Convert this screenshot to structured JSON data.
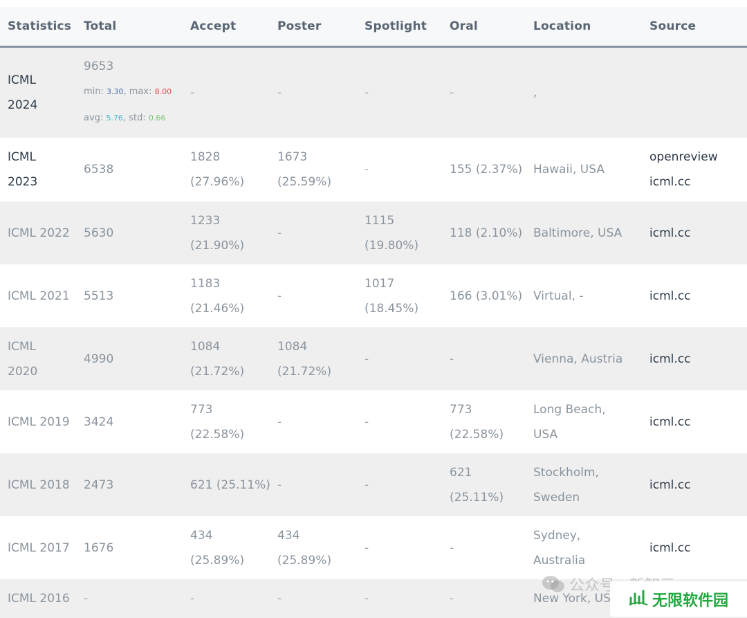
{
  "headers": [
    "Statistics",
    "Total",
    "Accept",
    "Poster",
    "Spotlight",
    "Oral",
    "Location",
    "Source"
  ],
  "rows": [
    {
      "stat_line1": "ICML",
      "stat_line2": "2024",
      "total": "9653",
      "total_min_label": "min: ",
      "total_min": "3.30",
      "total_max_label": ", max: ",
      "total_max": "8.00",
      "total_avg_label": "avg: ",
      "total_avg": "5.76",
      "total_std_label": ", std: ",
      "total_std": "0.66",
      "accept": "-",
      "poster": "-",
      "spotlight": "-",
      "oral": "-",
      "location": ",",
      "source": ""
    },
    {
      "stat_line1": "ICML",
      "stat_line2": "2023",
      "total": "6538",
      "accept_line1": "1828",
      "accept_line2": "(27.96%)",
      "poster_line1": "1673",
      "poster_line2": "(25.59%)",
      "spotlight": "-",
      "oral": "155 (2.37%)",
      "location": "Hawaii, USA",
      "source_line1": "openreview",
      "source_line2": "icml.cc"
    },
    {
      "stat": "ICML 2022",
      "total": "5630",
      "accept_line1": "1233",
      "accept_line2": "(21.90%)",
      "poster": "-",
      "spotlight_line1": "1115",
      "spotlight_line2": "(19.80%)",
      "oral": "118 (2.10%)",
      "location": "Baltimore, USA",
      "source": "icml.cc"
    },
    {
      "stat": "ICML 2021",
      "total": "5513",
      "accept_line1": "1183",
      "accept_line2": "(21.46%)",
      "poster": "-",
      "spotlight_line1": "1017",
      "spotlight_line2": "(18.45%)",
      "oral": "166 (3.01%)",
      "location": "Virtual, -",
      "source": "icml.cc"
    },
    {
      "stat_line1": "ICML",
      "stat_line2": "2020",
      "total": "4990",
      "accept_line1": "1084",
      "accept_line2": "(21.72%)",
      "poster_line1": "1084",
      "poster_line2": "(21.72%)",
      "spotlight": "-",
      "oral": "-",
      "location": "Vienna, Austria",
      "source": "icml.cc"
    },
    {
      "stat": "ICML 2019",
      "total": "3424",
      "accept_line1": "773",
      "accept_line2": "(22.58%)",
      "poster": "-",
      "spotlight": "-",
      "oral_line1": "773",
      "oral_line2": "(22.58%)",
      "location_line1": "Long Beach,",
      "location_line2": "USA",
      "source": "icml.cc"
    },
    {
      "stat": "ICML 2018",
      "total": "2473",
      "accept": "621 (25.11%)",
      "poster": "-",
      "spotlight": "-",
      "oral_line1": "621",
      "oral_line2": "(25.11%)",
      "location_line1": "Stockholm,",
      "location_line2": "Sweden",
      "source": "icml.cc"
    },
    {
      "stat": "ICML 2017",
      "total": "1676",
      "accept_line1": "434",
      "accept_line2": "(25.89%)",
      "poster_line1": "434",
      "poster_line2": "(25.89%)",
      "spotlight": "-",
      "oral": "-",
      "location_line1": "Sydney,",
      "location_line2": "Australia",
      "source": "icml.cc"
    },
    {
      "stat": "ICML 2016",
      "total": "-",
      "accept": "-",
      "poster": "-",
      "spotlight": "-",
      "oral": "-",
      "location": "New York, US",
      "source": ""
    }
  ],
  "watermark": {
    "chat_text": "公众号 · 新智元",
    "badge_text": "无限软件园",
    "icon": "wechat-icon",
    "badge_icon": "chart-bars-icon",
    "badge_color": "#22a83e"
  }
}
